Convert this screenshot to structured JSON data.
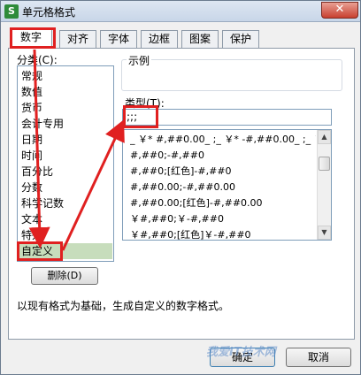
{
  "window": {
    "title": "单元格格式",
    "close_glyph": "✕",
    "app_icon": "S"
  },
  "tabs": [
    {
      "label": "数字",
      "active": true
    },
    {
      "label": "对齐",
      "active": false
    },
    {
      "label": "字体",
      "active": false
    },
    {
      "label": "边框",
      "active": false
    },
    {
      "label": "图案",
      "active": false
    },
    {
      "label": "保护",
      "active": false
    }
  ],
  "category": {
    "label": "分类(C):",
    "items": [
      "常规",
      "数值",
      "货币",
      "会计专用",
      "日期",
      "时间",
      "百分比",
      "分数",
      "科学记数",
      "文本",
      "特殊",
      "自定义"
    ],
    "selected": "自定义"
  },
  "delete_button": "删除(D)",
  "sample": {
    "label": "示例"
  },
  "type": {
    "label": "类型(T):",
    "value": ";;;",
    "formats": [
      "_ ￥* #,##0.00_ ;_ ￥* -#,##0.00_ ;_ ￥* \"-\"??_ ;_ @_ ",
      "#,##0;-#,##0",
      "#,##0;[红色]-#,##0",
      "#,##0.00;-#,##0.00",
      "#,##0.00;[红色]-#,##0.00",
      "￥#,##0;￥-#,##0",
      "￥#,##0;[红色]￥-#,##0"
    ]
  },
  "description": "以现有格式为基础，生成自定义的数字格式。",
  "buttons": {
    "ok": "确定",
    "cancel": "取消"
  },
  "watermark": "我爱IT技术网",
  "colors": {
    "highlight": "#e02020",
    "selected": "#c7ddbc",
    "app_icon": "#2e8b3a"
  }
}
